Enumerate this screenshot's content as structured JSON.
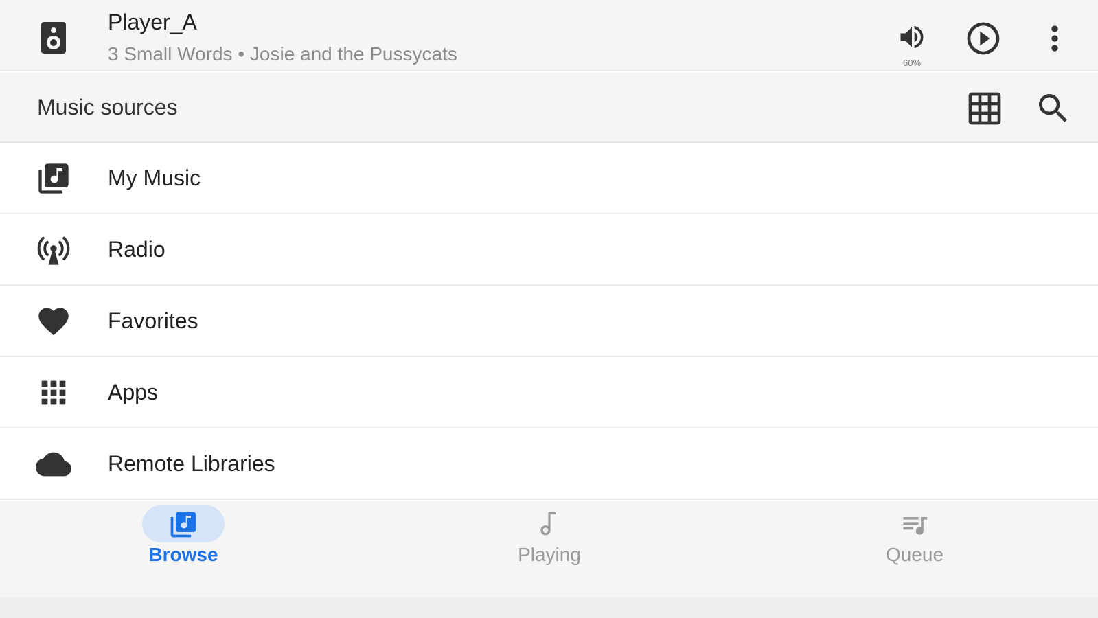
{
  "player": {
    "name": "Player_A",
    "track": "3 Small Words • Josie and the Pussycats",
    "volume_label": "60%",
    "icons": {
      "device": "speaker-icon",
      "volume": "volume-up-icon",
      "play": "play-circle-icon",
      "more": "more-vert-icon"
    }
  },
  "section": {
    "title": "Music sources",
    "icons": {
      "view": "grid-view-icon",
      "search": "search-icon"
    }
  },
  "sources": [
    {
      "label": "My Music",
      "icon": "library-music-icon"
    },
    {
      "label": "Radio",
      "icon": "radio-tower-icon"
    },
    {
      "label": "Favorites",
      "icon": "heart-icon"
    },
    {
      "label": "Apps",
      "icon": "apps-icon"
    },
    {
      "label": "Remote Libraries",
      "icon": "cloud-icon"
    }
  ],
  "nav": {
    "active": "Browse",
    "tabs": [
      {
        "label": "Browse",
        "icon": "library-music-icon"
      },
      {
        "label": "Playing",
        "icon": "music-note-icon"
      },
      {
        "label": "Queue",
        "icon": "queue-music-icon"
      }
    ]
  },
  "colors": {
    "accent": "#1a73e8",
    "active_pill": "#d6e4f7",
    "bar_background": "#f5f5f5",
    "icon": "#333333",
    "inactive": "#9a9a9a"
  }
}
